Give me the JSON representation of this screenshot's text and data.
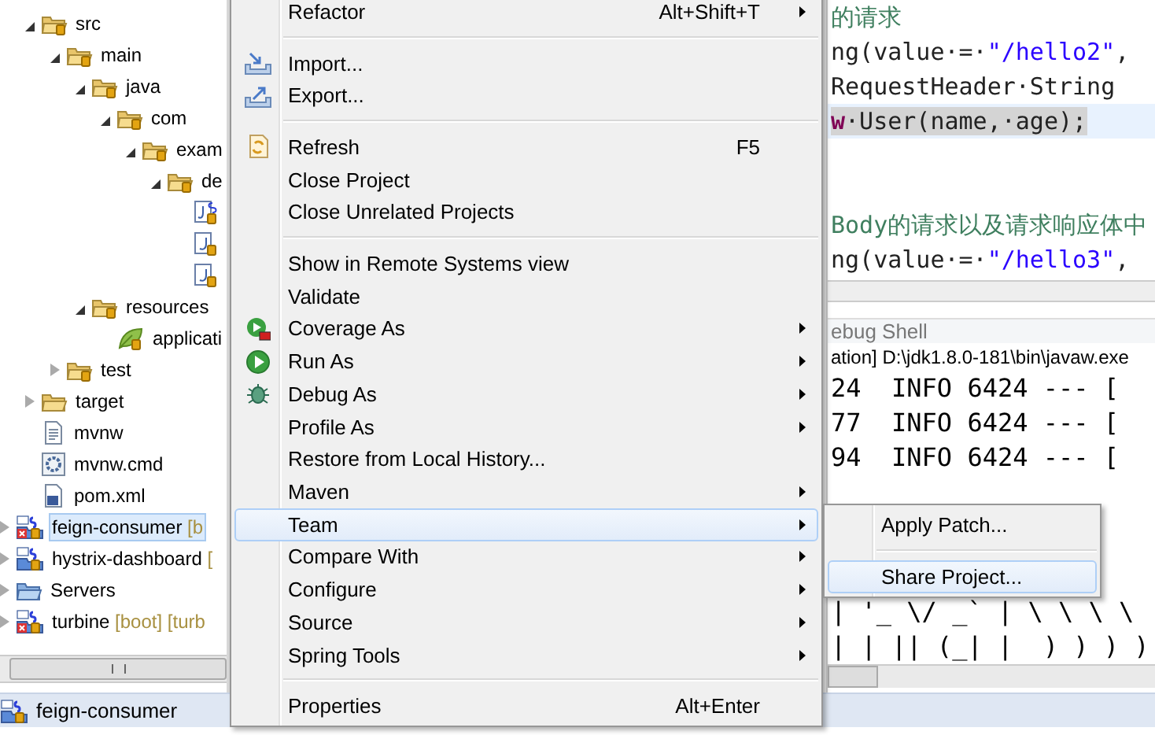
{
  "tree": {
    "open_project_children": [
      {
        "label": "src",
        "kind": "source",
        "expanded": true,
        "children": [
          {
            "label": "main",
            "kind": "source",
            "expanded": true,
            "children": [
              {
                "label": "java",
                "kind": "source",
                "expanded": true,
                "children": [
                  {
                    "label": "com",
                    "kind": "source",
                    "expanded": true,
                    "children": [
                      {
                        "label": "exam",
                        "kind": "source",
                        "expanded": true,
                        "children": [
                          {
                            "label": "de",
                            "kind": "source",
                            "expanded": true,
                            "children": [
                              {
                                "kind": "spring-java"
                              },
                              {
                                "kind": "java"
                              },
                              {
                                "kind": "java"
                              }
                            ]
                          }
                        ]
                      }
                    ]
                  }
                ]
              },
              {
                "label": "resources",
                "kind": "source",
                "expanded": true,
                "children": [
                  {
                    "label": "applicati",
                    "kind": "leaf"
                  }
                ]
              }
            ]
          },
          {
            "label": "test",
            "kind": "source",
            "expanded": false
          }
        ]
      },
      {
        "label": "target",
        "kind": "folder",
        "expanded": false
      },
      {
        "label": "mvnw",
        "kind": "text"
      },
      {
        "label": "mvnw.cmd",
        "kind": "gear"
      },
      {
        "label": "pom.xml",
        "kind": "maven"
      }
    ],
    "projects": [
      {
        "label": "feign-consumer",
        "decoration": "[b",
        "kind": "project-error",
        "selected": true,
        "expanded": false
      },
      {
        "label": "hystrix-dashboard",
        "decoration": "[",
        "kind": "project",
        "selected": false,
        "expanded": false
      },
      {
        "label": "Servers",
        "kind": "servers",
        "selected": false,
        "expanded": false
      },
      {
        "label": "turbine",
        "decoration": "[boot] [turb",
        "kind": "project-error",
        "selected": false,
        "expanded": false
      }
    ]
  },
  "status_bar": {
    "text": "feign-consumer"
  },
  "editor": {
    "lines": [
      {
        "current": false,
        "segments": [
          {
            "kind": "comment",
            "text": "的请求"
          }
        ]
      },
      {
        "current": false,
        "segments": [
          {
            "kind": "plain",
            "text": "ng(value·=·"
          },
          {
            "kind": "string",
            "text": "\"/hello2\""
          },
          {
            "kind": "plain",
            "text": ","
          }
        ]
      },
      {
        "current": false,
        "segments": [
          {
            "kind": "plain",
            "text": "RequestHeader·String"
          }
        ]
      },
      {
        "current": true,
        "segments": [
          {
            "kind": "keyword",
            "text": "w"
          },
          {
            "kind": "plain",
            "text": "·User(name,·age);"
          }
        ]
      },
      {
        "current": false
      },
      {
        "current": false
      },
      {
        "current": false,
        "segments": [
          {
            "kind": "comment",
            "text": "Body的请求以及请求响应体中"
          }
        ]
      },
      {
        "current": false,
        "segments": [
          {
            "kind": "plain",
            "text": "ng(value·=·"
          },
          {
            "kind": "string",
            "text": "\"/hello3\""
          },
          {
            "kind": "plain",
            "text": ","
          }
        ]
      }
    ]
  },
  "console": {
    "tab": "ebug Shell",
    "path": "ation] D:\\jdk1.8.0-181\\bin\\javaw.exe",
    "lines": [
      "24  INFO 6424 --- [",
      "77  INFO 6424 --- [",
      "94  INFO 6424 --- ["
    ],
    "banner": [
      "| '_ \\/ _` | \\ \\ \\ \\",
      "| | || (_| |  ) ) ) )"
    ]
  },
  "context_menu": {
    "items": [
      {
        "kind": "item",
        "label": "Refactor",
        "shortcut": "Alt+Shift+T",
        "submenu": true,
        "selected": false
      },
      {
        "kind": "separator"
      },
      {
        "kind": "item",
        "label": "Import...",
        "submenu": false,
        "selected": false
      },
      {
        "kind": "item",
        "label": "Export...",
        "submenu": false,
        "selected": false
      },
      {
        "kind": "separator"
      },
      {
        "kind": "item",
        "label": "Refresh",
        "shortcut": "F5",
        "submenu": false,
        "selected": false
      },
      {
        "kind": "item",
        "label": "Close Project",
        "submenu": false,
        "selected": false
      },
      {
        "kind": "item",
        "label": "Close Unrelated Projects",
        "submenu": false,
        "selected": false
      },
      {
        "kind": "separator"
      },
      {
        "kind": "item",
        "label": "Show in Remote Systems view",
        "submenu": false,
        "selected": false
      },
      {
        "kind": "item",
        "label": "Validate",
        "submenu": false,
        "selected": false
      },
      {
        "kind": "item",
        "label": "Coverage As",
        "submenu": true,
        "selected": false
      },
      {
        "kind": "item",
        "label": "Run As",
        "submenu": true,
        "selected": false
      },
      {
        "kind": "item",
        "label": "Debug As",
        "submenu": true,
        "selected": false
      },
      {
        "kind": "item",
        "label": "Profile As",
        "submenu": true,
        "selected": false
      },
      {
        "kind": "item",
        "label": "Restore from Local History...",
        "submenu": false,
        "selected": false
      },
      {
        "kind": "item",
        "label": "Maven",
        "submenu": true,
        "selected": false
      },
      {
        "kind": "item",
        "label": "Team",
        "submenu": true,
        "selected": true
      },
      {
        "kind": "item",
        "label": "Compare With",
        "submenu": true,
        "selected": false
      },
      {
        "kind": "item",
        "label": "Configure",
        "submenu": true,
        "selected": false
      },
      {
        "kind": "item",
        "label": "Source",
        "submenu": true,
        "selected": false
      },
      {
        "kind": "item",
        "label": "Spring Tools",
        "submenu": true,
        "selected": false
      },
      {
        "kind": "separator"
      },
      {
        "kind": "item",
        "label": "Properties",
        "shortcut": "Alt+Enter",
        "submenu": false,
        "selected": false
      }
    ]
  },
  "submenu": {
    "items": [
      {
        "kind": "item",
        "label": "Apply Patch...",
        "selected": false
      },
      {
        "kind": "separator"
      },
      {
        "kind": "item",
        "label": "Share Project...",
        "selected": true
      }
    ]
  }
}
